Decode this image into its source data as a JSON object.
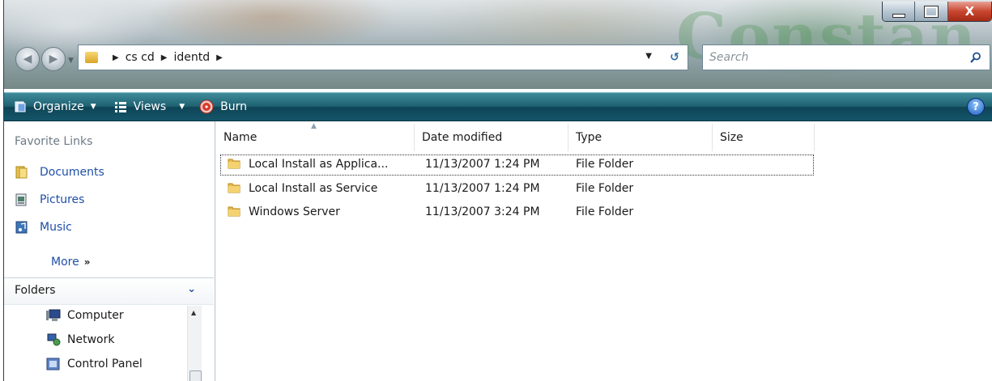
{
  "window": {
    "minimize_glyph": "min",
    "maximize_glyph": "max",
    "close_glyph": "X",
    "watermark": "Constan"
  },
  "address": {
    "crumbs": [
      "cs cd",
      "identd"
    ]
  },
  "search": {
    "placeholder": "Search"
  },
  "toolbar": {
    "organize": "Organize",
    "views": "Views",
    "burn": "Burn",
    "help": "?"
  },
  "navpane": {
    "favorite_links_title": "Favorite Links",
    "links": [
      "Documents",
      "Pictures",
      "Music"
    ],
    "more": "More",
    "folders_label": "Folders",
    "tree": [
      "Computer",
      "Network",
      "Control Panel"
    ]
  },
  "filelist": {
    "columns": [
      "Name",
      "Date modified",
      "Type",
      "Size"
    ],
    "rows": [
      {
        "name": "Local Install as Applica...",
        "date": "11/13/2007 1:24 PM",
        "type": "File Folder",
        "size": ""
      },
      {
        "name": "Local Install as Service",
        "date": "11/13/2007 1:24 PM",
        "type": "File Folder",
        "size": ""
      },
      {
        "name": "Windows Server",
        "date": "11/13/2007 3:24 PM",
        "type": "File Folder",
        "size": ""
      }
    ]
  },
  "colors": {
    "command_bar": "#1f6172",
    "link_blue": "#1f4fa8",
    "folder_yellow": "#e8b94a"
  }
}
